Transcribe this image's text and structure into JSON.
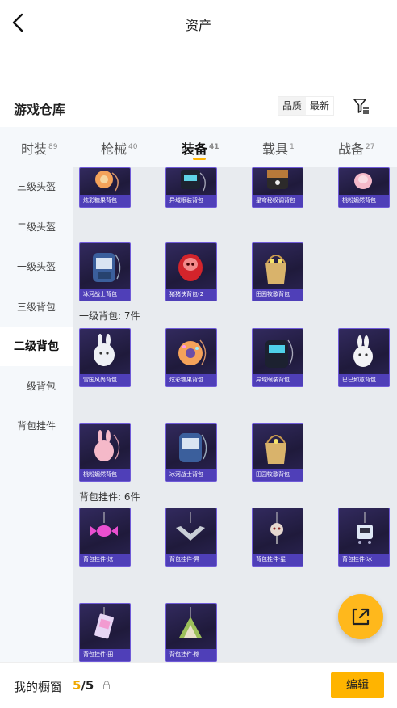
{
  "page": {
    "title": "资产"
  },
  "warehouse": {
    "title": "游戏仓库",
    "sort": {
      "options": [
        "品质",
        "最新"
      ],
      "selected": "最新"
    }
  },
  "tabs": [
    {
      "label": "时装",
      "count": "89"
    },
    {
      "label": "枪械",
      "count": "40"
    },
    {
      "label": "装备",
      "count": "41",
      "active": true
    },
    {
      "label": "载具",
      "count": "1"
    },
    {
      "label": "战备",
      "count": "27"
    }
  ],
  "sidebar": {
    "items": [
      "三级头盔",
      "二级头盔",
      "一级头盔",
      "三级背包",
      "二级背包",
      "一级背包",
      "背包挂件"
    ],
    "selected": "二级背包"
  },
  "groups": {
    "level2_backpacks": {
      "items_top": [
        "炫彩糖果背包",
        "异域眼装背包",
        "星穹秘叹调背包",
        "桃粉媚然背包"
      ],
      "items": [
        "冰河战士背包",
        "猪猪侠背包(2",
        "田园牧歌背包"
      ]
    },
    "level1_backpacks": {
      "label": "一级背包: 7件",
      "items": [
        "雪国风尚背包",
        "炫彩糖果背包",
        "异域眼装背包",
        "巳巳如意背包",
        "桃粉媚然背包",
        "冰河战士背包",
        "田园牧歌背包"
      ]
    },
    "pendants": {
      "label": "背包挂件: 6件",
      "items": [
        "背包挂件·炫",
        "背包挂件·异",
        "背包挂件·星",
        "背包挂件·冰",
        "背包挂件·田",
        "背包挂件·粽"
      ]
    }
  },
  "bottom": {
    "label": "我的橱窗",
    "count_current": "5",
    "count_total": "/5",
    "edit_label": "编辑"
  },
  "colors": {
    "accent": "#ffb400",
    "card_caption": "#4f3fb8",
    "card_border": "#6f5ad8"
  },
  "icons": [
    "back-arrow-icon",
    "filter-icon",
    "lock-icon",
    "share-icon"
  ]
}
